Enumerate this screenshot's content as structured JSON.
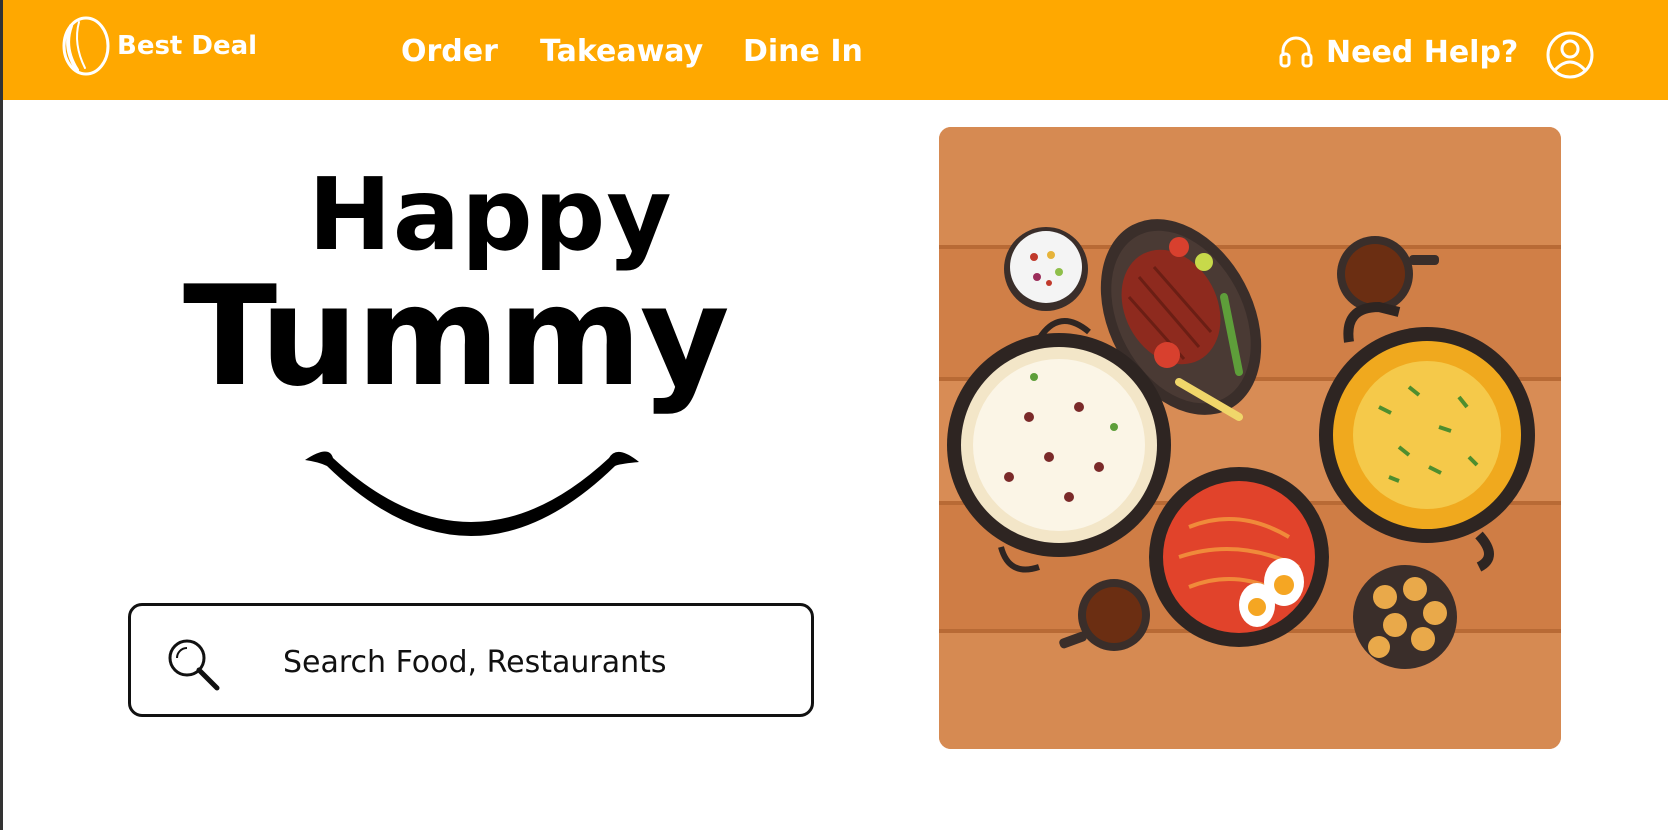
{
  "header": {
    "logo_text": "Best Deal",
    "nav": [
      {
        "label": "Order"
      },
      {
        "label": "Takeaway"
      },
      {
        "label": "Dine In"
      }
    ],
    "help_label": "Need Help?",
    "icons": {
      "logo": "logo-icon",
      "help": "headphones-icon",
      "profile": "user-icon"
    }
  },
  "hero": {
    "line1": "Happy",
    "line2": "Tummy"
  },
  "search": {
    "placeholder": "Search Food, Restaurants",
    "icon": "search-icon"
  },
  "colors": {
    "brand": "#FFA800",
    "wood_light": "#D4834A",
    "wood_dark": "#B86A35",
    "text": "#000000"
  }
}
